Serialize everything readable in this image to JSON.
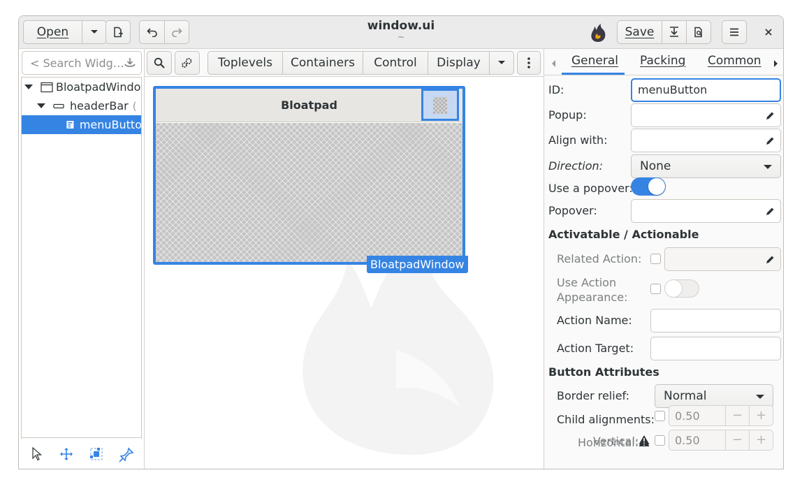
{
  "header": {
    "open_label": "Open",
    "save_label": "Save",
    "title": "window.ui",
    "subtitle": "~"
  },
  "left": {
    "search_placeholder": "< Search Widg…",
    "tree": [
      {
        "label": "BloatpadWindo",
        "icon": "window-icon",
        "expanded": true
      },
      {
        "label": "headerBar",
        "icon": "headerbar-icon",
        "expanded": true
      },
      {
        "label": "menuButto",
        "icon": "menubutton-icon",
        "selected": true
      }
    ]
  },
  "center": {
    "palette_tabs": [
      "Toplevels",
      "Containers",
      "Control",
      "Display"
    ],
    "preview": {
      "title": "Bloatpad",
      "window_label": "BloatpadWindow"
    }
  },
  "right": {
    "tabs": [
      "General",
      "Packing",
      "Common"
    ],
    "active_tab": "General",
    "props": {
      "id_label": "ID:",
      "id_value": "menuButton",
      "popup_label": "Popup:",
      "align_label": "Align with:",
      "direction_label": "Direction:",
      "direction_value": "None",
      "popover_switch_label": "Use a popover:",
      "popover_switch_on": true,
      "popover_label": "Popover:",
      "section_actionable": "Activatable / Actionable",
      "related_action_label": "Related Action:",
      "use_action_label_1": "Use Action",
      "use_action_label_2": "Appearance:",
      "action_name_label": "Action Name:",
      "action_target_label": "Action Target:",
      "section_button": "Button Attributes",
      "border_relief_label": "Border relief:",
      "border_relief_value": "Normal",
      "child_align_label": "Child alignments:",
      "horizontal_label": "Horizontal:",
      "horizontal_value": "0.50",
      "vertical_label": "Vertical:",
      "vertical_value": "0.50"
    }
  },
  "colors": {
    "accent": "#3584e4",
    "headerbar": "#ebebeb"
  }
}
